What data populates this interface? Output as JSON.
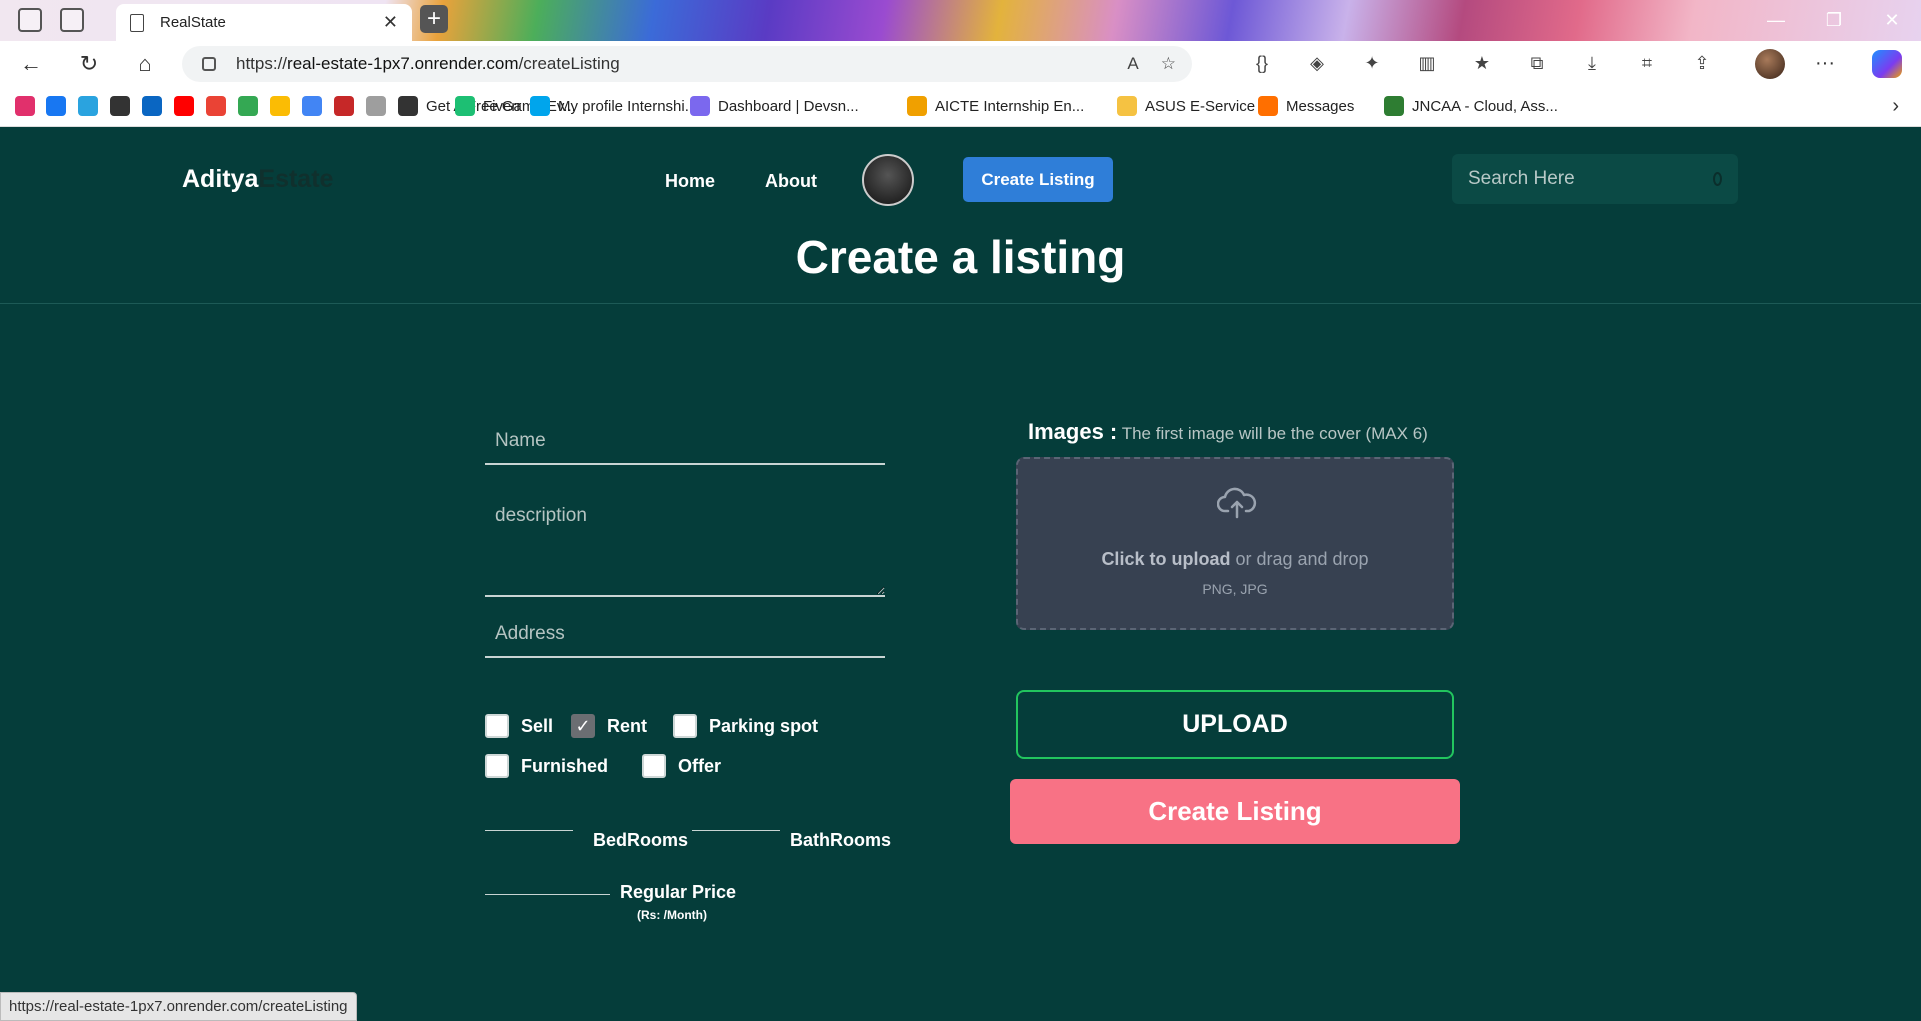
{
  "browser": {
    "tab_title": "RealState",
    "new_tab_symbol": "+",
    "url_scheme": "https://",
    "url_host": "real-estate-1px7.onrender.com",
    "url_path": "/createListing",
    "status_url": "https://real-estate-1px7.onrender.com/createListing",
    "bookmarks": [
      {
        "label": "",
        "icon": "instagram-icon",
        "color": "#e1306c"
      },
      {
        "label": "",
        "icon": "facebook-icon",
        "color": "#1877f2"
      },
      {
        "label": "",
        "icon": "telegram-icon",
        "color": "#2aa3df"
      },
      {
        "label": "",
        "icon": "github-icon",
        "color": "#333333"
      },
      {
        "label": "",
        "icon": "linkedin-icon",
        "color": "#0a66c2"
      },
      {
        "label": "",
        "icon": "youtube-icon",
        "color": "#ff0000"
      },
      {
        "label": "",
        "icon": "gmail-icon",
        "color": "#ea4335"
      },
      {
        "label": "",
        "icon": "drive-icon",
        "color": "#34a853"
      },
      {
        "label": "",
        "icon": "photos-icon",
        "color": "#fbbc04"
      },
      {
        "label": "",
        "icon": "filter-icon",
        "color": "#4285f4"
      },
      {
        "label": "",
        "icon": "live-icon",
        "color": "#c62828"
      },
      {
        "label": "",
        "icon": "docs-icon",
        "color": "#9e9e9e"
      },
      {
        "label": "Get A Free Game Ev...",
        "icon": "epic-games-icon",
        "color": "#333333"
      },
      {
        "label": "Fiverr",
        "icon": "fiverr-icon",
        "color": "#1dbf73"
      },
      {
        "label": "My profile Internshi...",
        "icon": "internshala-icon",
        "color": "#00a5ec"
      },
      {
        "label": "Dashboard | Devsn...",
        "icon": "devsnest-icon",
        "color": "#7b68ee"
      },
      {
        "label": "AICTE Internship En...",
        "icon": "aicte-icon",
        "color": "#f0a000"
      },
      {
        "label": "ASUS E-Service",
        "icon": "folder-icon",
        "color": "#f5c242"
      },
      {
        "label": "Messages",
        "icon": "messages-icon",
        "color": "#ff6f00"
      },
      {
        "label": "JNCAA - Cloud, Ass...",
        "icon": "jncaa-icon",
        "color": "#2e7d32"
      }
    ]
  },
  "header": {
    "brand_primary": "Aditya",
    "brand_secondary": "Estate",
    "nav": [
      "Home",
      "About"
    ],
    "create_button": "Create Listing",
    "search_placeholder": "Search Here"
  },
  "form": {
    "title": "Create a listing",
    "name_placeholder": "Name",
    "description_placeholder": "description",
    "address_placeholder": "Address",
    "checkboxes_row1": [
      {
        "label": "Sell",
        "checked": false
      },
      {
        "label": "Rent",
        "checked": true
      },
      {
        "label": "Parking spot",
        "checked": false
      }
    ],
    "checkboxes_row2": [
      {
        "label": "Furnished",
        "checked": false
      },
      {
        "label": "Offer",
        "checked": false
      }
    ],
    "bedrooms_label": "BedRooms",
    "bathrooms_label": "BathRooms",
    "price_label": "Regular Price",
    "price_unit": "(Rs: /Month)",
    "images_label": "Images :",
    "images_hint": "The first image will be the cover (MAX 6)",
    "dropzone_click": "Click to upload",
    "dropzone_rest": "or drag and drop",
    "dropzone_types": "PNG, JPG",
    "upload_button": "UPLOAD",
    "submit_button": "Create Listing"
  },
  "colors": {
    "page_bg": "#053d3a",
    "create_button": "#2f7ed8",
    "upload_border": "#22c55e",
    "submit_button": "#f87285",
    "dropzone_bg": "#374151"
  }
}
